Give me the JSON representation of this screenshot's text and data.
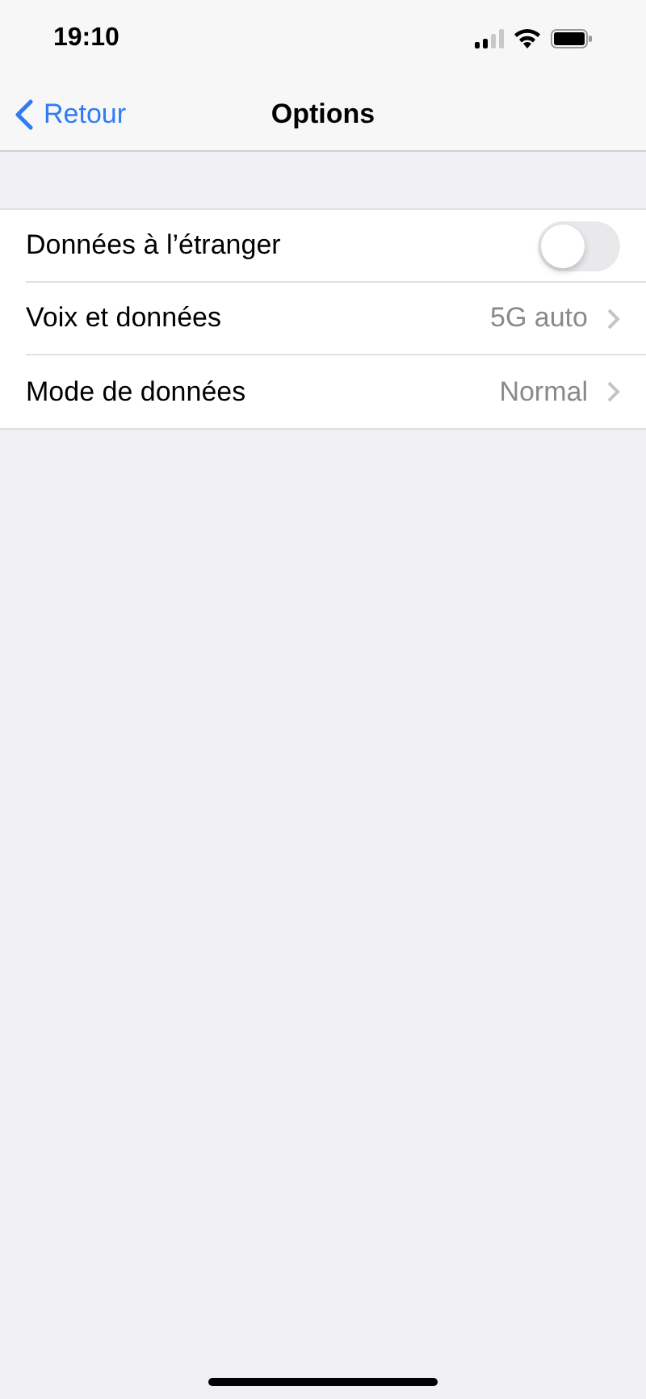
{
  "status_bar": {
    "time": "19:10"
  },
  "nav_bar": {
    "back": "Retour",
    "title": "Options"
  },
  "rows": [
    {
      "kind": "toggle",
      "label": "Données à l’étranger",
      "on": false
    },
    {
      "kind": "detail",
      "label": "Voix et données",
      "value": "5G auto"
    },
    {
      "kind": "detail",
      "label": "Mode de données",
      "value": "Normal"
    }
  ]
}
